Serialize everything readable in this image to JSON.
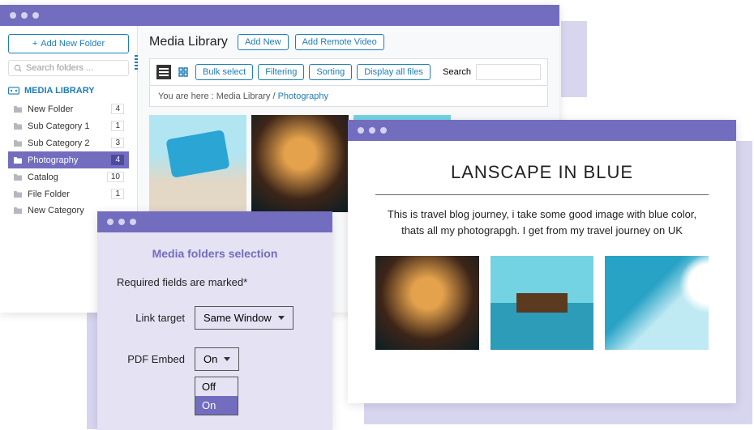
{
  "sidebar": {
    "add_folder": "Add New Folder",
    "search_placeholder": "Search folders ...",
    "root_label": "MEDIA LIBRARY",
    "folders": [
      {
        "name": "New Folder",
        "count": "4",
        "active": false
      },
      {
        "name": "Sub Category 1",
        "count": "1",
        "active": false
      },
      {
        "name": "Sub Category 2",
        "count": "3",
        "active": false
      },
      {
        "name": "Photography",
        "count": "4",
        "active": true
      },
      {
        "name": "Catalog",
        "count": "10",
        "active": false
      },
      {
        "name": "File Folder",
        "count": "1",
        "active": false
      },
      {
        "name": "New Category",
        "count": "",
        "active": false
      }
    ]
  },
  "header": {
    "title": "Media Library",
    "add_new": "Add New",
    "add_remote": "Add Remote Video"
  },
  "toolbar": {
    "bulk": "Bulk select",
    "filtering": "Filtering",
    "sorting": "Sorting",
    "display_all": "Display all files",
    "search_label": "Search"
  },
  "breadcrumb": {
    "prefix": "You are here  :",
    "path1": "Media Library",
    "sep": "/",
    "path2": "Photography"
  },
  "blog": {
    "title": "LANSCAPE IN BLUE",
    "desc": "This is travel blog journey, i take some good image with blue color, thats all my photograpgh. I get from my travel journey on UK"
  },
  "settings": {
    "title": "Media folders selection",
    "required": "Required fields are marked*",
    "link_target_label": "Link target",
    "link_target_value": "Same Window",
    "pdf_label": "PDF Embed",
    "pdf_value": "On",
    "options": {
      "off": "Off",
      "on": "On"
    }
  }
}
